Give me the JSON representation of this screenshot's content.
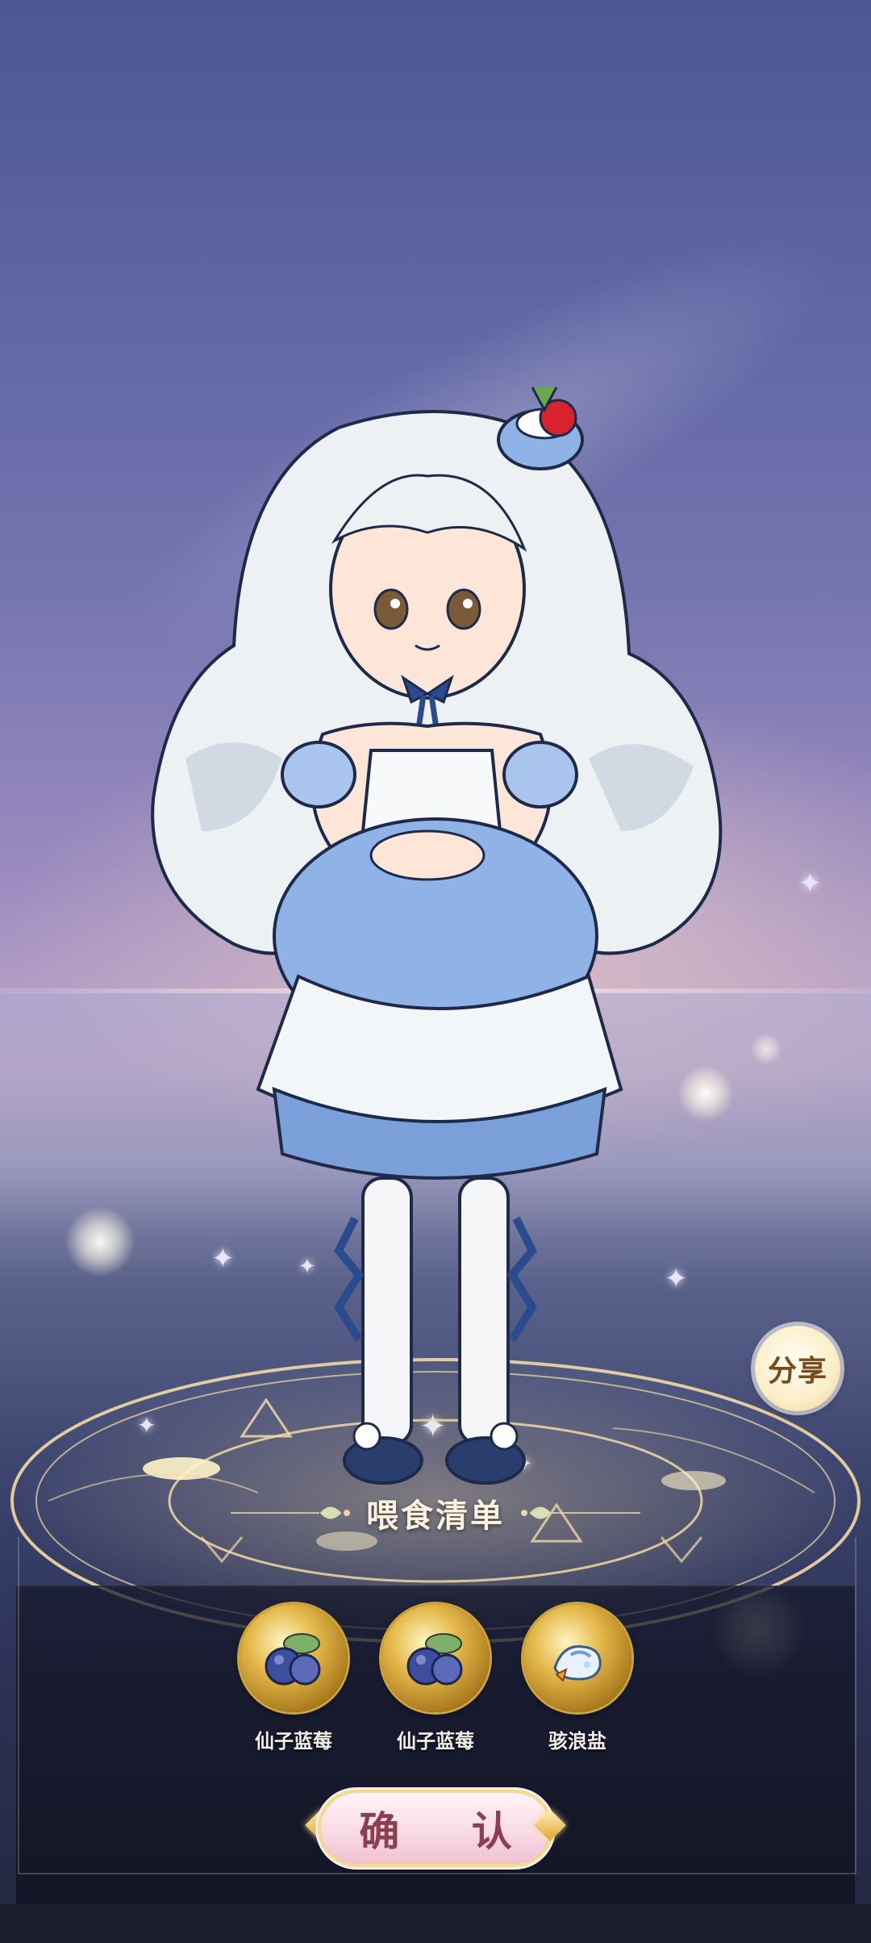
{
  "share": {
    "label": "分享"
  },
  "feeding": {
    "title": "喂食清单",
    "items": [
      {
        "name": "仙子蓝莓",
        "icon": "blueberry-icon"
      },
      {
        "name": "仙子蓝莓",
        "icon": "blueberry-icon"
      },
      {
        "name": "骇浪盐",
        "icon": "sea-salt-icon"
      }
    ],
    "confirm_label": "确 认"
  },
  "colors": {
    "sky_top": "#4c5793",
    "sky_glow": "#c2a9c9",
    "gold": "#cfa53b",
    "confirm_text": "#8a3f52",
    "dress_blue": "#8fb3e6"
  }
}
